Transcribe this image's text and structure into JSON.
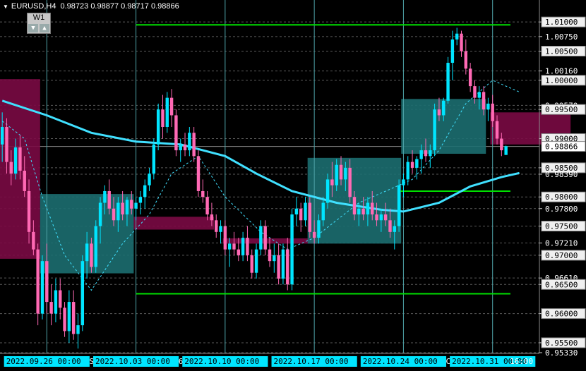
{
  "header": {
    "symbol_timeframe": "EURUSD,H4",
    "ohlc": "0.98723 0.98877 0.98717 0.98866"
  },
  "timeframe_button": {
    "label": "W1"
  },
  "chart_data": {
    "type": "candlestick",
    "title": "EURUSD,H4",
    "ylim": [
      0.9533,
      1.0128
    ],
    "y_ticks": [
      "1.01000",
      "1.00750",
      "1.00500",
      "1.00160",
      "1.00000",
      "0.99570",
      "0.99500",
      "0.99000",
      "0.98500",
      "0.98390",
      "0.98000",
      "0.97800",
      "0.97500",
      "0.97210",
      "0.97000",
      "0.96610",
      "0.96500",
      "0.96000",
      "0.95500",
      "0.95330"
    ],
    "current_price": "0.98866",
    "x_labels": [
      {
        "text": "2022.09.26 00:00",
        "bar": 10,
        "highlight": true
      },
      {
        "text": "S",
        "bar": 20,
        "highlight": false
      },
      {
        "text": "2022.10.03 00:00",
        "bar": 30,
        "highlight": true
      },
      {
        "text": "6",
        "bar": 40,
        "highlight": false
      },
      {
        "text": "2022.10.10 00:00",
        "bar": 50,
        "highlight": true
      },
      {
        "text": "2022.10.17 00:00",
        "bar": 70,
        "highlight": true
      },
      {
        "text": "2022.10.24 00:00",
        "bar": 90,
        "highlight": true
      },
      {
        "text": "C",
        "bar": 100,
        "highlight": false
      },
      {
        "text": "2022.10.31 00:00",
        "bar": 110,
        "highlight": true
      },
      {
        "text": "16:00",
        "bar": 122,
        "highlight": false
      }
    ],
    "day_separator_bars": [
      10,
      30,
      50,
      70,
      90,
      110
    ],
    "horizontal_levels": [
      {
        "price": 1.0095,
        "from_bar": 30,
        "to_bar": 114,
        "color": "#00e000"
      },
      {
        "price": 0.981,
        "from_bar": 89,
        "to_bar": 114,
        "color": "#00e000"
      },
      {
        "price": 0.9634,
        "from_bar": 30,
        "to_bar": 114,
        "color": "#00e000"
      }
    ],
    "zones": [
      {
        "from_bar": 0,
        "to_bar": 8,
        "top": 1.0002,
        "bottom": 0.9694,
        "color": "#7a0a44"
      },
      {
        "from_bar": 9,
        "to_bar": 29,
        "top": 0.9805,
        "bottom": 0.9669,
        "color": "#1c6e70"
      },
      {
        "from_bar": 30,
        "to_bar": 47,
        "top": 0.9766,
        "bottom": 0.9744,
        "color": "#7a0a44"
      },
      {
        "from_bar": 50,
        "to_bar": 70,
        "top": 0.9729,
        "bottom": 0.972,
        "color": "#7a0a44"
      },
      {
        "from_bar": 69,
        "to_bar": 89,
        "top": 0.9867,
        "bottom": 0.972,
        "color": "#1c6e70"
      },
      {
        "from_bar": 90,
        "to_bar": 108,
        "top": 0.9968,
        "bottom": 0.9874,
        "color": "#1c6e70"
      },
      {
        "from_bar": 110,
        "to_bar": 127,
        "top": 0.9945,
        "bottom": 0.989,
        "color": "#7a0a44"
      }
    ],
    "colors": {
      "up": "#00e5ff",
      "down": "#ff69b4",
      "ma": "#40e0ff",
      "grid": "#5a5a5a",
      "separator": "#4fa3a8",
      "axis_text": "#ffffff"
    },
    "ma_solid": [
      [
        0,
        0.9965
      ],
      [
        10,
        0.994
      ],
      [
        20,
        0.991
      ],
      [
        30,
        0.9895
      ],
      [
        40,
        0.989
      ],
      [
        50,
        0.987
      ],
      [
        57,
        0.984
      ],
      [
        65,
        0.981
      ],
      [
        75,
        0.979
      ],
      [
        85,
        0.9778
      ],
      [
        90,
        0.9775
      ],
      [
        98,
        0.979
      ],
      [
        105,
        0.9818
      ],
      [
        112,
        0.9834
      ],
      [
        116,
        0.9841
      ]
    ],
    "ma_dashed": [
      [
        0,
        0.993
      ],
      [
        5,
        0.99
      ],
      [
        9,
        0.98
      ],
      [
        14,
        0.97
      ],
      [
        20,
        0.964
      ],
      [
        27,
        0.972
      ],
      [
        33,
        0.977
      ],
      [
        38,
        0.984
      ],
      [
        44,
        0.987
      ],
      [
        50,
        0.98
      ],
      [
        58,
        0.974
      ],
      [
        64,
        0.971
      ],
      [
        70,
        0.973
      ],
      [
        80,
        0.979
      ],
      [
        86,
        0.981
      ],
      [
        92,
        0.983
      ],
      [
        98,
        0.988
      ],
      [
        104,
        0.996
      ],
      [
        110,
        1.0
      ],
      [
        116,
        0.998
      ]
    ],
    "bars": [
      [
        0.989,
        0.9945,
        0.986,
        0.992
      ],
      [
        0.992,
        0.9935,
        0.984,
        0.986
      ],
      [
        0.986,
        0.988,
        0.982,
        0.984
      ],
      [
        0.984,
        0.99,
        0.983,
        0.9885
      ],
      [
        0.9885,
        0.9905,
        0.983,
        0.9845
      ],
      [
        0.9845,
        0.987,
        0.98,
        0.981
      ],
      [
        0.981,
        0.983,
        0.972,
        0.974
      ],
      [
        0.974,
        0.976,
        0.97,
        0.971
      ],
      [
        0.971,
        0.972,
        0.958,
        0.96
      ],
      [
        0.96,
        0.97,
        0.959,
        0.969
      ],
      [
        0.969,
        0.972,
        0.96,
        0.962
      ],
      [
        0.962,
        0.965,
        0.958,
        0.96
      ],
      [
        0.96,
        0.966,
        0.9585,
        0.964
      ],
      [
        0.964,
        0.966,
        0.959,
        0.961
      ],
      [
        0.961,
        0.962,
        0.956,
        0.957
      ],
      [
        0.957,
        0.964,
        0.955,
        0.962
      ],
      [
        0.962,
        0.964,
        0.9555,
        0.9565
      ],
      [
        0.9565,
        0.96,
        0.954,
        0.958
      ],
      [
        0.958,
        0.97,
        0.957,
        0.969
      ],
      [
        0.969,
        0.974,
        0.966,
        0.972
      ],
      [
        0.972,
        0.973,
        0.967,
        0.968
      ],
      [
        0.968,
        0.976,
        0.967,
        0.975
      ],
      [
        0.975,
        0.98,
        0.972,
        0.979
      ],
      [
        0.979,
        0.982,
        0.977,
        0.981
      ],
      [
        0.981,
        0.983,
        0.977,
        0.978
      ],
      [
        0.978,
        0.98,
        0.975,
        0.976
      ],
      [
        0.976,
        0.98,
        0.974,
        0.979
      ],
      [
        0.979,
        0.981,
        0.976,
        0.977
      ],
      [
        0.977,
        0.98,
        0.975,
        0.9795
      ],
      [
        0.9795,
        0.981,
        0.977,
        0.978
      ],
      [
        0.978,
        0.98,
        0.976,
        0.979
      ],
      [
        0.979,
        0.981,
        0.977,
        0.98
      ],
      [
        0.98,
        0.983,
        0.978,
        0.982
      ],
      [
        0.982,
        0.985,
        0.981,
        0.984
      ],
      [
        0.984,
        0.99,
        0.983,
        0.989
      ],
      [
        0.989,
        0.996,
        0.988,
        0.995
      ],
      [
        0.995,
        0.9975,
        0.99,
        0.992
      ],
      [
        0.992,
        0.998,
        0.991,
        0.997
      ],
      [
        0.997,
        0.9985,
        0.992,
        0.994
      ],
      [
        0.994,
        0.995,
        0.987,
        0.988
      ],
      [
        0.988,
        0.99,
        0.986,
        0.989
      ],
      [
        0.989,
        0.991,
        0.987,
        0.988
      ],
      [
        0.988,
        0.992,
        0.987,
        0.991
      ],
      [
        0.991,
        0.992,
        0.986,
        0.987
      ],
      [
        0.987,
        0.988,
        0.98,
        0.981
      ],
      [
        0.981,
        0.983,
        0.979,
        0.98
      ],
      [
        0.98,
        0.981,
        0.976,
        0.977
      ],
      [
        0.977,
        0.979,
        0.975,
        0.976
      ],
      [
        0.976,
        0.977,
        0.973,
        0.974
      ],
      [
        0.974,
        0.976,
        0.972,
        0.975
      ],
      [
        0.975,
        0.976,
        0.97,
        0.971
      ],
      [
        0.971,
        0.973,
        0.968,
        0.972
      ],
      [
        0.972,
        0.974,
        0.97,
        0.971
      ],
      [
        0.971,
        0.973,
        0.969,
        0.97
      ],
      [
        0.97,
        0.974,
        0.969,
        0.973
      ],
      [
        0.973,
        0.975,
        0.969,
        0.97
      ],
      [
        0.97,
        0.971,
        0.966,
        0.967
      ],
      [
        0.967,
        0.972,
        0.966,
        0.971
      ],
      [
        0.971,
        0.976,
        0.97,
        0.975
      ],
      [
        0.975,
        0.976,
        0.97,
        0.971
      ],
      [
        0.971,
        0.973,
        0.968,
        0.969
      ],
      [
        0.969,
        0.972,
        0.967,
        0.97
      ],
      [
        0.97,
        0.972,
        0.965,
        0.966
      ],
      [
        0.966,
        0.972,
        0.965,
        0.971
      ],
      [
        0.971,
        0.973,
        0.964,
        0.965
      ],
      [
        0.965,
        0.978,
        0.964,
        0.977
      ],
      [
        0.977,
        0.98,
        0.975,
        0.978
      ],
      [
        0.978,
        0.979,
        0.974,
        0.976
      ],
      [
        0.976,
        0.98,
        0.975,
        0.979
      ],
      [
        0.979,
        0.98,
        0.973,
        0.974
      ],
      [
        0.974,
        0.976,
        0.972,
        0.973
      ],
      [
        0.973,
        0.977,
        0.972,
        0.976
      ],
      [
        0.976,
        0.98,
        0.975,
        0.979
      ],
      [
        0.979,
        0.984,
        0.978,
        0.983
      ],
      [
        0.983,
        0.986,
        0.98,
        0.982
      ],
      [
        0.982,
        0.9865,
        0.981,
        0.9855
      ],
      [
        0.9855,
        0.987,
        0.982,
        0.983
      ],
      [
        0.983,
        0.986,
        0.981,
        0.985
      ],
      [
        0.985,
        0.9865,
        0.979,
        0.98
      ],
      [
        0.98,
        0.981,
        0.976,
        0.977
      ],
      [
        0.977,
        0.979,
        0.975,
        0.978
      ],
      [
        0.978,
        0.98,
        0.976,
        0.977
      ],
      [
        0.977,
        0.98,
        0.975,
        0.979
      ],
      [
        0.979,
        0.981,
        0.976,
        0.977
      ],
      [
        0.977,
        0.979,
        0.975,
        0.976
      ],
      [
        0.976,
        0.978,
        0.974,
        0.977
      ],
      [
        0.977,
        0.979,
        0.975,
        0.976
      ],
      [
        0.976,
        0.978,
        0.973,
        0.974
      ],
      [
        0.974,
        0.976,
        0.971,
        0.975
      ],
      [
        0.975,
        0.983,
        0.974,
        0.982
      ],
      [
        0.982,
        0.984,
        0.98,
        0.983
      ],
      [
        0.983,
        0.987,
        0.982,
        0.986
      ],
      [
        0.986,
        0.988,
        0.984,
        0.985
      ],
      [
        0.985,
        0.987,
        0.983,
        0.9865
      ],
      [
        0.9865,
        0.989,
        0.984,
        0.988
      ],
      [
        0.988,
        0.99,
        0.986,
        0.987
      ],
      [
        0.987,
        0.989,
        0.985,
        0.988
      ],
      [
        0.988,
        0.996,
        0.987,
        0.995
      ],
      [
        0.995,
        0.997,
        0.993,
        0.994
      ],
      [
        0.994,
        0.997,
        0.993,
        0.9965
      ],
      [
        0.9965,
        1.004,
        0.996,
        1.003
      ],
      [
        1.003,
        1.0085,
        1.0,
        1.007
      ],
      [
        1.007,
        1.009,
        1.006,
        1.008
      ],
      [
        1.008,
        1.0085,
        1.004,
        1.005
      ],
      [
        1.005,
        1.007,
        1.001,
        1.002
      ],
      [
        1.002,
        1.003,
        0.998,
        0.999
      ],
      [
        0.999,
        1.0,
        0.996,
        0.997
      ],
      [
        0.997,
        0.999,
        0.995,
        0.998
      ],
      [
        0.998,
        0.999,
        0.994,
        0.995
      ],
      [
        0.995,
        0.997,
        0.993,
        0.996
      ],
      [
        0.996,
        0.9975,
        0.992,
        0.993
      ],
      [
        0.993,
        0.994,
        0.989,
        0.99
      ],
      [
        0.99,
        0.991,
        0.987,
        0.988
      ],
      [
        0.9872,
        0.9888,
        0.9872,
        0.9887
      ]
    ]
  }
}
